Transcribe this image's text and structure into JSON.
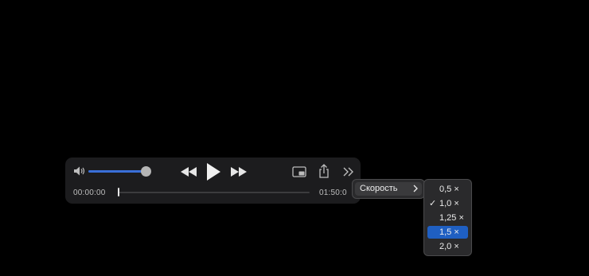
{
  "player": {
    "volume_level": 0.85,
    "current_time": "00:00:00",
    "end_time": "01:50:0",
    "progress": 0.0
  },
  "icons": {
    "volume": "speaker-icon",
    "rewind": "rewind-icon",
    "play": "play-icon",
    "fast_forward": "fast-forward-icon",
    "pip": "picture-in-picture-icon",
    "share": "share-icon",
    "more": "more-chevrons-icon"
  },
  "menu": {
    "speed_label": "Скорость",
    "speed_options": [
      {
        "label": "0,5 ×",
        "checked": false,
        "highlighted": false
      },
      {
        "label": "1,0 ×",
        "checked": true,
        "highlighted": false
      },
      {
        "label": "1,25 ×",
        "checked": false,
        "highlighted": false
      },
      {
        "label": "1,5 ×",
        "checked": false,
        "highlighted": true
      },
      {
        "label": "2,0 ×",
        "checked": false,
        "highlighted": false
      }
    ],
    "check_mark": "✓"
  },
  "colors": {
    "accent": "#1f5fc2",
    "volume_fill": "#3a6fd8",
    "bar_bg": "#1c1c1e"
  }
}
